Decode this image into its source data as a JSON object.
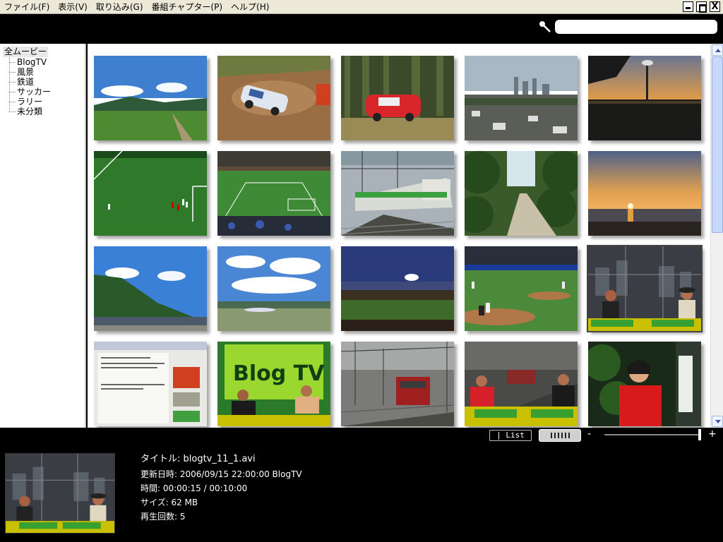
{
  "menubar": {
    "items": [
      {
        "label": "ファイル(F)"
      },
      {
        "label": "表示(V)"
      },
      {
        "label": "取り込み(G)"
      },
      {
        "label": "番組チャプター(P)"
      },
      {
        "label": "ヘルプ(H)"
      }
    ],
    "close_glyph": "X"
  },
  "search": {
    "value": "",
    "placeholder": ""
  },
  "sidebar": {
    "root": "全ムービー",
    "items": [
      {
        "label": "BlogTV"
      },
      {
        "label": "風景"
      },
      {
        "label": "鉄道"
      },
      {
        "label": "サッカー"
      },
      {
        "label": "ラリー"
      },
      {
        "label": "未分類"
      }
    ]
  },
  "thumbnails": [
    {
      "subject": "green field under blue sky"
    },
    {
      "subject": "rally car on dirt road"
    },
    {
      "subject": "red rally car in forest"
    },
    {
      "subject": "city skyline"
    },
    {
      "subject": "stadium at sunset"
    },
    {
      "subject": "soccer pitch players"
    },
    {
      "subject": "soccer stadium crowd"
    },
    {
      "subject": "commuter train"
    },
    {
      "subject": "forest path"
    },
    {
      "subject": "sunset over sea"
    },
    {
      "subject": "green hill and sky"
    },
    {
      "subject": "airport with clouds"
    },
    {
      "subject": "baseball stadium dusk"
    },
    {
      "subject": "baseball game"
    },
    {
      "subject": "BlogTV studio hosts"
    },
    {
      "subject": "web page screenshot"
    },
    {
      "subject": "BlogTV set"
    },
    {
      "subject": "red locomotive"
    },
    {
      "subject": "BlogTV hosts with city"
    },
    {
      "subject": "woman in red shirt"
    }
  ],
  "toolbar": {
    "list_label": "| List",
    "zoom_minus": "-",
    "zoom_plus": "+",
    "zoom_level": 1.0
  },
  "details": {
    "title": "タイトル: blogtv_11_1.avi",
    "updated": "更新日時: 2006/09/15 22:00:00 BlogTV",
    "time": "時間: 00:00:15 / 00:10:00",
    "size": "サイズ: 62 MB",
    "plays": "再生回数: 5"
  },
  "colors": {
    "background": "#000000",
    "grid_bg": "#ffffff",
    "menubar": "#ece9d8"
  }
}
